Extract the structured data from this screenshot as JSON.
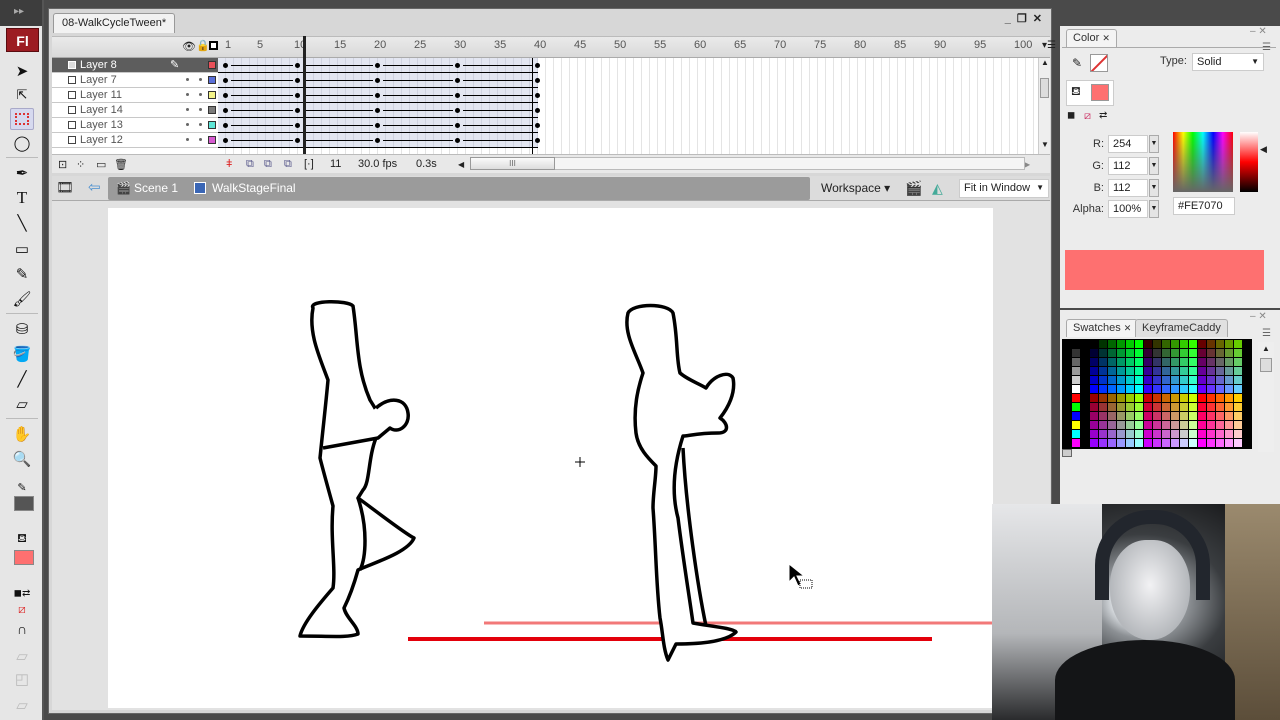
{
  "app": {
    "logo": "Fl",
    "toolbar_grip": "▸▸"
  },
  "document": {
    "tab_title": "08-WalkCycleTween*",
    "window_controls": [
      "_",
      "❐",
      "✕"
    ]
  },
  "timeline": {
    "header_icons": {
      "eye": "eye-icon",
      "lock": "lock-icon",
      "outline": "outline-icon"
    },
    "ruler": [
      "1",
      "5",
      "10",
      "15",
      "20",
      "25",
      "30",
      "35",
      "40",
      "45",
      "50",
      "55",
      "60",
      "65",
      "70",
      "75",
      "80",
      "85",
      "90",
      "95",
      "100"
    ],
    "layers": [
      {
        "name": "Layer 8",
        "color": "#e8505a",
        "selected": true
      },
      {
        "name": "Layer 7",
        "color": "#5a6fd8",
        "selected": false
      },
      {
        "name": "Layer 11",
        "color": "#f4f48a",
        "selected": false
      },
      {
        "name": "Layer 14",
        "color": "#7a7a7a",
        "selected": false
      },
      {
        "name": "Layer 13",
        "color": "#5ee6d8",
        "selected": false
      },
      {
        "name": "Layer 12",
        "color": "#d65ad0",
        "selected": false
      }
    ],
    "keyframes": [
      1,
      10,
      20,
      30,
      40
    ],
    "current_frame": "11",
    "frame_rate": "30.0 fps",
    "elapsed_time": "0.3s"
  },
  "editbar": {
    "scene": "Scene 1",
    "symbol": "WalkStageFinal",
    "workspace": "Workspace ▾",
    "zoom": "Fit in Window"
  },
  "color_panel": {
    "tab": "Color",
    "type_label": "Type:",
    "type_value": "Solid",
    "r_label": "R:",
    "r": "254",
    "g_label": "G:",
    "g": "112",
    "b_label": "B:",
    "b": "112",
    "alpha_label": "Alpha:",
    "alpha": "100%",
    "hex": "#FE7070",
    "fill_color": "#fe7070"
  },
  "swatches_panel": {
    "tabs": [
      "Swatches",
      "KeyframeCaddy"
    ]
  },
  "stage": {
    "ground_color": "#e3000b",
    "ghost_ground_color": "#f27878"
  }
}
